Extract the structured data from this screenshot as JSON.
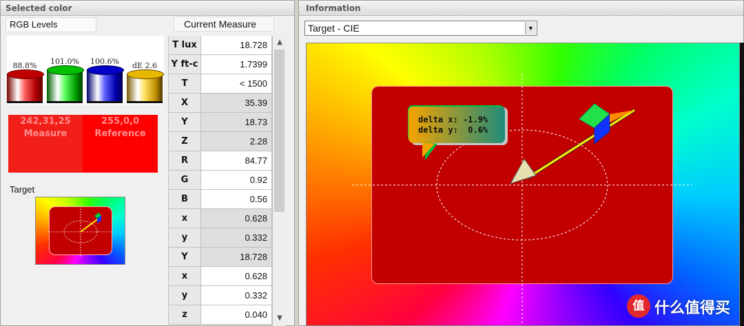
{
  "left_panel": {
    "title": "Selected color",
    "rgb_levels_label": "RGB Levels",
    "current_measure_tab": "Current Measure",
    "cylinders": [
      {
        "name": "red",
        "pct": "88.8%",
        "color": "#d81010"
      },
      {
        "name": "green",
        "pct": "101.0%",
        "color": "#10c010"
      },
      {
        "name": "blue",
        "pct": "100.6%",
        "color": "#1010d8"
      },
      {
        "name": "de",
        "pct": "dE 2.6",
        "color": "#e8b800"
      }
    ],
    "swatch": {
      "measure_value": "242,31,25",
      "measure_label": "Measure",
      "measure_color": "#f21f19",
      "reference_value": "255,0,0",
      "reference_label": "Reference",
      "reference_color": "#ff0000"
    },
    "target_label": "Target",
    "table": [
      {
        "label": "T lux",
        "value": "18.728"
      },
      {
        "label": "Y ft-c",
        "value": "1.7399"
      },
      {
        "label": "T",
        "value": "< 1500"
      },
      {
        "label": "X",
        "value": "35.39"
      },
      {
        "label": "Y",
        "value": "18.73"
      },
      {
        "label": "Z",
        "value": "2.28"
      },
      {
        "label": "R",
        "value": "84.77"
      },
      {
        "label": "G",
        "value": "0.92"
      },
      {
        "label": "B",
        "value": "0.56"
      },
      {
        "label": "x",
        "value": "0.628"
      },
      {
        "label": "y",
        "value": "0.332"
      },
      {
        "label": "Y",
        "value": "18.728"
      },
      {
        "label": "x",
        "value": "0.628"
      },
      {
        "label": "y",
        "value": "0.332"
      },
      {
        "label": "z",
        "value": "0.040"
      }
    ]
  },
  "right_panel": {
    "title": "Information",
    "dropdown_value": "Target - CIE",
    "callout": {
      "line1": "delta x: -1.9%",
      "line2": "delta y:  0.6%"
    },
    "colors": {
      "target_box": "#c20000"
    }
  },
  "watermark": {
    "text": "什么值得买",
    "icon_glyph": "值"
  }
}
